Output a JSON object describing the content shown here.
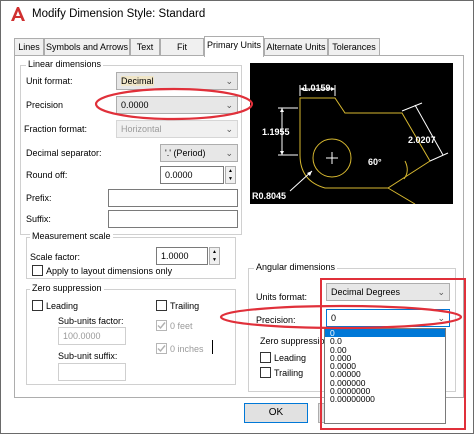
{
  "window": {
    "title": "Modify Dimension Style: Standard"
  },
  "tabs": [
    "Lines",
    "Symbols and Arrows",
    "Text",
    "Fit",
    "Primary Units",
    "Alternate Units",
    "Tolerances"
  ],
  "linear": {
    "group_title": "Linear dimensions",
    "unit_format_label": "Unit format:",
    "unit_format_value": "Decimal",
    "precision_label": "Precision",
    "precision_value": "0.0000",
    "fraction_format_label": "Fraction format:",
    "fraction_format_value": "Horizontal",
    "decimal_separator_label": "Decimal separator:",
    "decimal_separator_value": "'.' (Period)",
    "round_off_label": "Round off:",
    "round_off_value": "0.0000",
    "prefix_label": "Prefix:",
    "prefix_value": "",
    "suffix_label": "Suffix:",
    "suffix_value": ""
  },
  "measurement": {
    "group_title": "Measurement scale",
    "scale_factor_label": "Scale factor:",
    "scale_factor_value": "1.0000",
    "apply_layout_label": "Apply to layout dimensions only"
  },
  "zero_suppression": {
    "group_title": "Zero suppression",
    "leading_label": "Leading",
    "trailing_label": "Trailing",
    "sub_units_factor_label": "Sub-units factor:",
    "sub_units_factor_value": "100.0000",
    "sub_unit_suffix_label": "Sub-unit suffix:",
    "feet_label": "0 feet",
    "inches_label": "0 inches"
  },
  "preview": {
    "dim_top": "1.0159",
    "dim_left": "1.1955",
    "dim_right": "2.0207",
    "dim_angle": "60°",
    "dim_radius": "R0.8045",
    "line_color": "#d7b830"
  },
  "angular": {
    "group_title": "Angular dimensions",
    "units_format_label": "Units format:",
    "units_format_value": "Decimal Degrees",
    "precision_label": "Precision:",
    "precision_value": "0",
    "zero_suppression_label": "Zero suppression",
    "leading_label": "Leading",
    "trailing_label": "Trailing",
    "precision_options": [
      "0",
      "0.0",
      "0.00",
      "0.000",
      "0.0000",
      "0.00000",
      "0.000000",
      "0.0000000",
      "0.00000000"
    ]
  },
  "buttons": {
    "ok_label": "OK"
  },
  "colors": {
    "annotation_red": "#e0303a",
    "selection_blue": "#0078d7",
    "accent_logo": "#d03030"
  }
}
